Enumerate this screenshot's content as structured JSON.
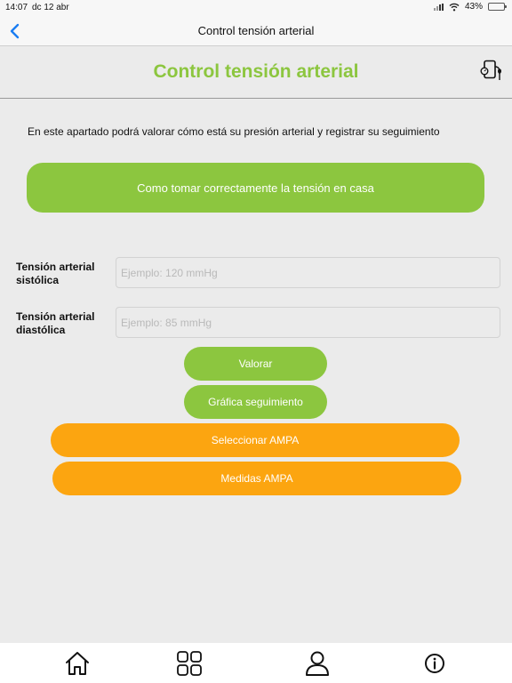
{
  "status_bar": {
    "time": "14:07",
    "date": "dc 12 abr",
    "battery_text": "43%",
    "battery_level": 0.43
  },
  "nav": {
    "title": "Control tensión arterial",
    "back_icon": "chevron-left-icon"
  },
  "header": {
    "title": "Control tensión arterial",
    "icon": "blood-pressure-monitor-icon"
  },
  "intro_text": "En este apartado podrá valorar cómo está su presión arterial y registrar su seguimiento",
  "guide_button": "Como tomar correctamente la tensión en casa",
  "form": {
    "systolic": {
      "label": "Tensión arterial sistólica",
      "value": "",
      "placeholder": "Ejemplo: 120 mmHg"
    },
    "diastolic": {
      "label": "Tensión arterial diastólica",
      "value": "",
      "placeholder": "Ejemplo: 85 mmHg"
    }
  },
  "actions": {
    "evaluate": "Valorar",
    "chart": "Gráfica seguimiento",
    "select_ampa": "Seleccionar AMPA",
    "ampa_measures": "Medidas AMPA"
  },
  "tab_bar": {
    "items": [
      "home-icon",
      "grid-icon",
      "user-icon",
      "info-icon"
    ]
  },
  "colors": {
    "accent_green": "#8cc63f",
    "accent_orange": "#fca510",
    "ios_blue": "#1a7df2"
  }
}
